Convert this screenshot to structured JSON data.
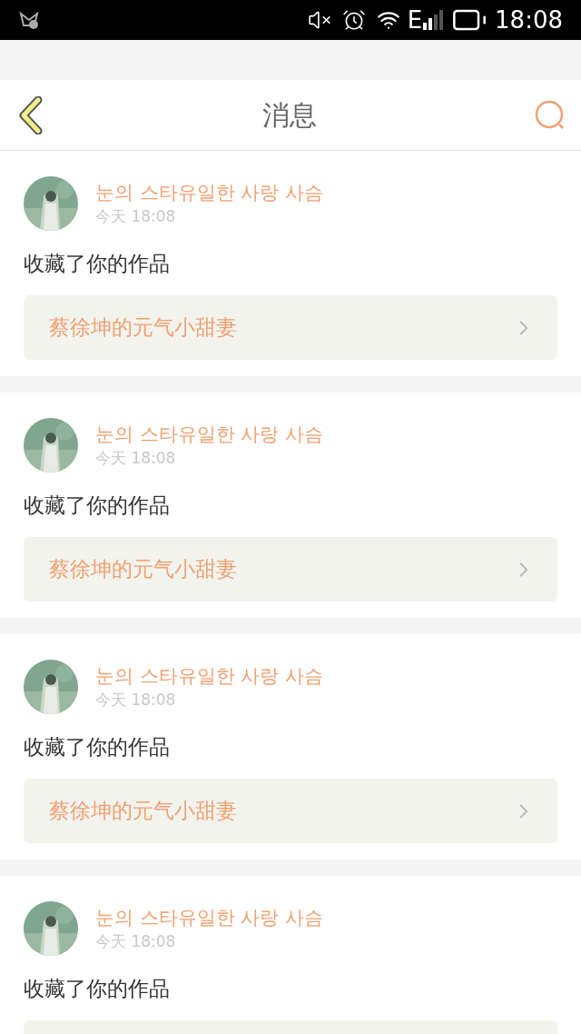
{
  "status_bar": {
    "network": "E",
    "time": "18:08"
  },
  "header": {
    "title": "消息"
  },
  "messages": [
    {
      "user": "눈의 스타유일한 사랑 사슴",
      "time": "今天 18:08",
      "action": "收藏了你的作品",
      "work": "蔡徐坤的元气小甜妻"
    },
    {
      "user": "눈의 스타유일한 사랑 사슴",
      "time": "今天 18:08",
      "action": "收藏了你的作品",
      "work": "蔡徐坤的元气小甜妻"
    },
    {
      "user": "눈의 스타유일한 사랑 사슴",
      "time": "今天 18:08",
      "action": "收藏了你的作品",
      "work": "蔡徐坤的元气小甜妻"
    },
    {
      "user": "눈의 스타유일한 사랑 사슴",
      "time": "今天 18:08",
      "action": "收藏了你的作品"
    }
  ]
}
